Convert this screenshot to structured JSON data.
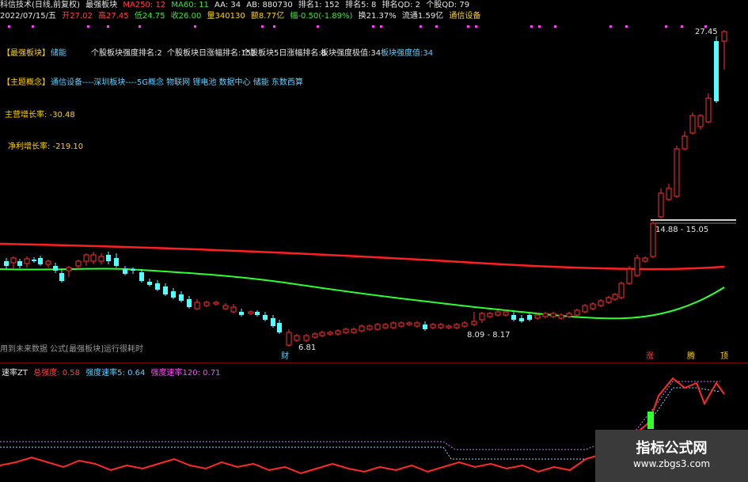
{
  "header": {
    "stock_name": "科信技术(日线,前复权)",
    "indicator": "最强板块",
    "ma250_label": "MA250: 12",
    "ma60_label": "MA60: 11",
    "aa_label": "AA: 34",
    "ab_label": "AB: 880730",
    "rank1_label": "排名1: 152",
    "rank5_label": "排名5: 8",
    "rankqd_label": "排名QD: 2",
    "stockqd_label": "个股QD: 79"
  },
  "quote": {
    "date": "2022/07/15/五",
    "open": "开27.02",
    "high": "高27.45",
    "low": "低24.75",
    "close": "收26.00",
    "volume": "量340130",
    "amount": "额8.77亿",
    "change": "幅-0.50(-1.89%)",
    "turnover": "换21.37%",
    "float": "流通1.59亿",
    "industry": "通信设备"
  },
  "panel": {
    "strongest_sector_tag": "【最强板块】",
    "strongest_sector_value": "储能",
    "stock_sector_rank": "个股板块强度排名:2",
    "sector_daily_rank": "个股板块日涨幅排名:152",
    "sector_5day_rank": "个股板块5日涨幅排名:8",
    "sector_strength_extreme": "板块强度极值:34",
    "sector_strength_value": "板块强度值:34",
    "theme_tag": "【主题概念】",
    "theme_value": "通信设备----深圳板块----5G概念 物联网 锂电池 数据中心 储能 东数西算",
    "revenue_growth": "主营增长率: -30.48",
    "profit_growth": "净利增长率: -219.10"
  },
  "annotations": {
    "high_price": "27.45",
    "range_label": "14.88 - 15.05",
    "low_price": "6.81",
    "low_range": "8.09 - 8.17",
    "fin_marker": "财",
    "future_notice": "用到未来数据 公式[最强板块]运行很耗时",
    "marker_rise": "涨",
    "marker_hot": "腾",
    "marker_top": "顶"
  },
  "subchart": {
    "title": "速率ZT",
    "total_strength": "总强度: 0.58",
    "strength_rate5": "强度速率5: 0.64",
    "strength_rate120": "强度速率120: 0.71"
  },
  "watermark": {
    "title": "指标公式网",
    "url": "www.zbgs3.com"
  },
  "colors": {
    "up": "#ff3030",
    "down": "#54ffff",
    "ma_long": "#ff2020",
    "ma_short": "#30ff30",
    "info_cyan": "#5fd0ff",
    "info_yellow": "#ffd200"
  }
}
